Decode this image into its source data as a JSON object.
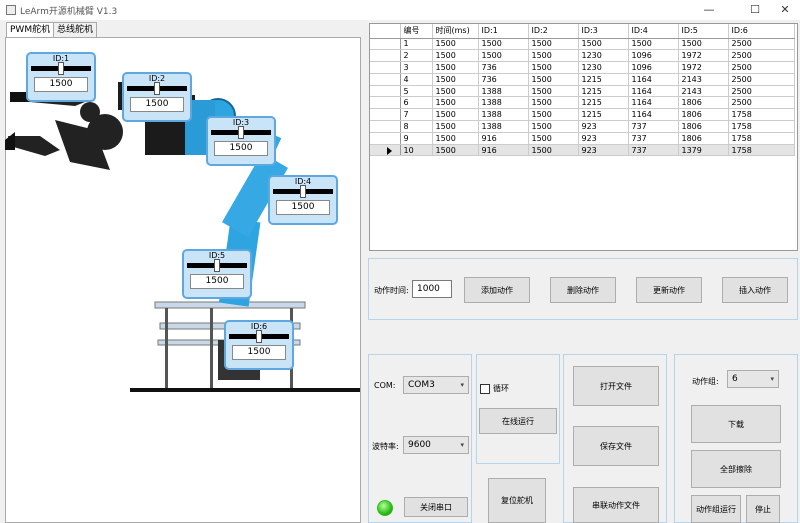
{
  "window": {
    "title": "LeArm开源机械臂 V1.3",
    "minimize": "—",
    "maximize": "☐",
    "close": "✕"
  },
  "tabs": [
    {
      "label": "PWM舵机",
      "active": true
    },
    {
      "label": "总线舵机",
      "active": false
    }
  ],
  "servos": [
    {
      "label": "ID:1",
      "value": "1500",
      "position": 0.5
    },
    {
      "label": "ID:2",
      "value": "1500",
      "position": 0.5
    },
    {
      "label": "ID:3",
      "value": "1500",
      "position": 0.5
    },
    {
      "label": "ID:4",
      "value": "1500",
      "position": 0.5
    },
    {
      "label": "ID:5",
      "value": "1500",
      "position": 0.5
    },
    {
      "label": "ID:6",
      "value": "1500",
      "position": 0.5
    }
  ],
  "grid": {
    "columns": [
      "编号",
      "时间(ms)",
      "ID:1",
      "ID:2",
      "ID:3",
      "ID:4",
      "ID:5",
      "ID:6"
    ],
    "selected_row": 9,
    "rows": [
      [
        "1",
        "1500",
        "1500",
        "1500",
        "1500",
        "1500",
        "1500",
        "2500"
      ],
      [
        "2",
        "1500",
        "1500",
        "1500",
        "1230",
        "1096",
        "1972",
        "2500"
      ],
      [
        "3",
        "1500",
        "736",
        "1500",
        "1230",
        "1096",
        "1972",
        "2500"
      ],
      [
        "4",
        "1500",
        "736",
        "1500",
        "1215",
        "1164",
        "2143",
        "2500"
      ],
      [
        "5",
        "1500",
        "1388",
        "1500",
        "1215",
        "1164",
        "2143",
        "2500"
      ],
      [
        "6",
        "1500",
        "1388",
        "1500",
        "1215",
        "1164",
        "1806",
        "2500"
      ],
      [
        "7",
        "1500",
        "1388",
        "1500",
        "1215",
        "1164",
        "1806",
        "1758"
      ],
      [
        "8",
        "1500",
        "1388",
        "1500",
        "923",
        "737",
        "1806",
        "1758"
      ],
      [
        "9",
        "1500",
        "916",
        "1500",
        "923",
        "737",
        "1806",
        "1758"
      ],
      [
        "10",
        "1500",
        "916",
        "1500",
        "923",
        "737",
        "1379",
        "1758"
      ]
    ]
  },
  "action": {
    "time_label": "动作时间:",
    "time_value": "1000",
    "add": "添加动作",
    "delete": "删除动作",
    "update": "更新动作",
    "insert": "插入动作"
  },
  "serial": {
    "com_label": "COM:",
    "com_value": "COM3",
    "baud_label": "波特率:",
    "baud_value": "9600",
    "close_port": "关闭串口",
    "led_color": "#2fbf1b"
  },
  "online": {
    "loop_label": "循环",
    "loop_checked": false,
    "run_online": "在线运行",
    "reset_servo": "复位舵机"
  },
  "files": {
    "open": "打开文件",
    "save": "保存文件",
    "concat": "串联动作文件"
  },
  "group": {
    "label": "动作组:",
    "value": "6",
    "download": "下载",
    "erase_all": "全部擦除",
    "run_group": "动作组运行",
    "stop": "停止"
  }
}
